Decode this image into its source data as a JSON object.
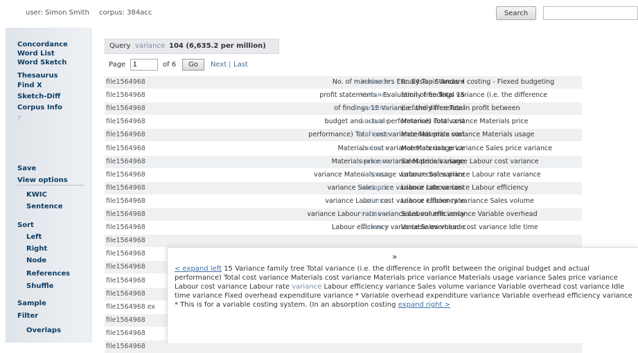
{
  "header": {
    "user": "user: Simon Smith",
    "corpus": "corpus: 384acc",
    "search_label": "Search",
    "search_value": ""
  },
  "sidebar": {
    "items": [
      "Concordance",
      "Word List",
      "Word Sketch",
      "Thesaurus",
      "Find X",
      "Sketch-Diff",
      "Corpus Info",
      "?",
      "Save",
      "View options",
      "KWIC",
      "Sentence",
      "Sort",
      "Left",
      "Right",
      "Node",
      "References",
      "Shuffle",
      "Sample",
      "Filter",
      "Overlaps"
    ]
  },
  "query": {
    "label": "Query",
    "term": "variance",
    "count": "104 (6,635.2 per million)"
  },
  "pager": {
    "page_label": "Page",
    "page_value": "1",
    "of_label": "of 6",
    "go_label": "Go",
    "next_label": "Next",
    "sep": "|",
    "last_label": "Last"
  },
  "rows": [
    {
      "ref": "file1564968",
      "left": "No. of machine hrs Etc. 14 Topic Areas •",
      "kw": "Variance",
      "right": "Analysis - Standard costing - Flexed budgeting"
    },
    {
      "ref": "file1564968",
      "left": "profit statements - Evaluation of findings 15",
      "kw": "Variance",
      "right": "family tree Total variance (i.e. the difference"
    },
    {
      "ref": "file1564968",
      "left": "of findings 15 Variance family tree Total",
      "kw": "variance",
      "right": "(i.e. the difference in profit between"
    },
    {
      "ref": "file1564968",
      "left": "budget and actual performance) Total cost",
      "kw": "variance",
      "right": "Materials cost variance Materials price"
    },
    {
      "ref": "file1564968",
      "left": "performance) Total cost variance Materials cost",
      "kw": "variance",
      "right": "Materials price variance Materials usage"
    },
    {
      "ref": "file1564968",
      "left": "Materials cost variance Materials price",
      "kw": "variance",
      "right": "Materials usage variance Sales price variance"
    },
    {
      "ref": "file1564968",
      "left": "Materials price variance Materials usage",
      "kw": "variance",
      "right": "Sales price variance Labour cost variance"
    },
    {
      "ref": "file1564968",
      "left": "variance Materials usage variance Sales price",
      "kw": "variance",
      "right": "Labour cost variance Labour rate variance"
    },
    {
      "ref": "file1564968",
      "left": "variance Sales price variance Labour cost",
      "kw": "variance",
      "right": "Labour rate variance Labour efficiency"
    },
    {
      "ref": "file1564968",
      "left": "variance Labour cost variance Labour rate",
      "kw": "variance",
      "right": "Labour efficiency variance Sales volume"
    },
    {
      "ref": "file1564968",
      "left": "variance Labour rate variance Labour efficiency",
      "kw": "variance",
      "right": "Sales volume variance Variable overhead"
    },
    {
      "ref": "file1564968",
      "left": "Labour efficiency variance Sales volume",
      "kw": "variance",
      "right": "Variable overhead cost variance Idle time"
    },
    {
      "ref": "file1564968",
      "left": "",
      "kw": "",
      "right": ""
    },
    {
      "ref": "file1564968",
      "left": "",
      "kw": "",
      "right": ""
    },
    {
      "ref": "file1564968",
      "left": "",
      "kw": "",
      "right": ""
    },
    {
      "ref": "file1564968",
      "left": "",
      "kw": "",
      "right": ""
    },
    {
      "ref": "file1564968",
      "left": "",
      "kw": "",
      "right": ""
    },
    {
      "ref": "file1564968 ex",
      "left": "",
      "kw": "",
      "right": ""
    },
    {
      "ref": "file1564968",
      "left": "",
      "kw": "",
      "right": ""
    },
    {
      "ref": "file1564968",
      "left": "",
      "kw": "",
      "right": ""
    },
    {
      "ref": "file1564968",
      "left": "",
      "kw": "",
      "right": ""
    }
  ],
  "popup": {
    "close_glyph": "»",
    "expand_left": "< expand left",
    "body": " 15 Variance family tree Total variance (i.e. the difference in profit between the original budget and actual performance) Total cost variance Materials cost variance Materials price variance Materials usage variance Sales price variance Labour cost variance Labour rate ",
    "kw": "variance",
    "body2": " Labour efficiency variance Sales volume variance Variable overhead cost variance Idle time variance Fixed overhead expenditure variance * Variable overhead expenditure variance Variable overhead efficiency variance * This is for a variable costing system. (In an absorption costing ",
    "expand_right": "expand right >"
  }
}
